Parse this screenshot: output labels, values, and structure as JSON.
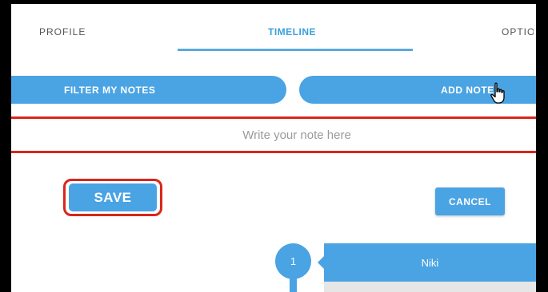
{
  "tabs": [
    {
      "label": "PROFILE"
    },
    {
      "label": "TIMELINE"
    },
    {
      "label": "OPTIO"
    }
  ],
  "actions": {
    "filter_label": "FILTER MY NOTES",
    "add_note_label": "ADD NOTE"
  },
  "note_input": {
    "placeholder": "Write your note here"
  },
  "form": {
    "save_label": "SAVE",
    "cancel_label": "CANCEL"
  },
  "timeline": {
    "entries": [
      {
        "number": "1",
        "author": "Niki"
      }
    ]
  },
  "colors": {
    "accent": "#4aa3e3",
    "highlight": "#d9261c"
  }
}
